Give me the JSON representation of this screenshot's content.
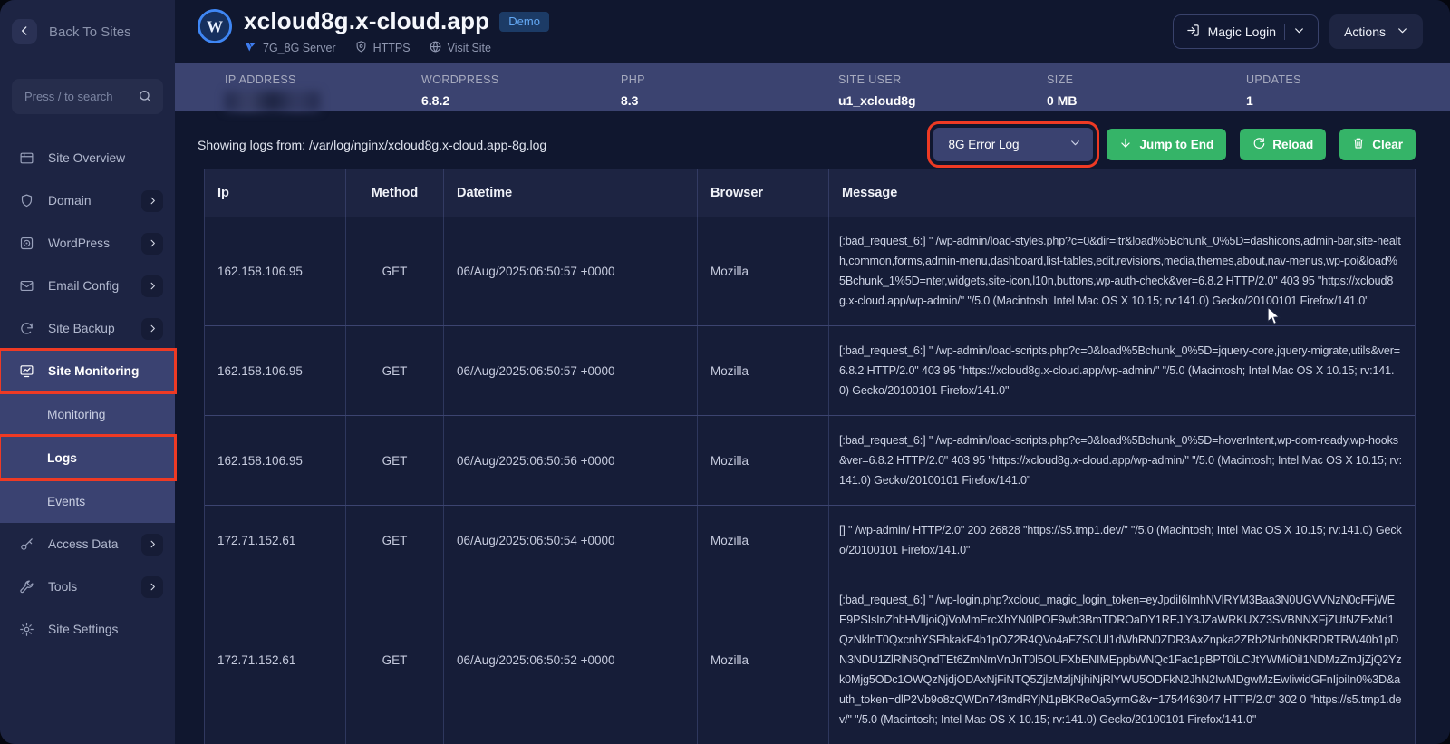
{
  "app": {
    "back_to_sites": "Back To Sites",
    "search_placeholder": "Press / to search"
  },
  "sidebar": {
    "items": [
      {
        "label": "Site Overview",
        "icon": "overview"
      },
      {
        "label": "Domain",
        "icon": "shield",
        "expandable": true
      },
      {
        "label": "WordPress",
        "icon": "wordpress",
        "expandable": true
      },
      {
        "label": "Email Config",
        "icon": "envelope",
        "expandable": true
      },
      {
        "label": "Site Backup",
        "icon": "backup",
        "expandable": true
      },
      {
        "label": "Site Monitoring",
        "icon": "monitoring",
        "active": true,
        "annotated": true
      },
      {
        "label": "Monitoring",
        "submenu": true
      },
      {
        "label": "Logs",
        "submenu": true,
        "active": true,
        "annotated": true
      },
      {
        "label": "Events",
        "submenu": true
      },
      {
        "label": "Access Data",
        "icon": "key",
        "expandable": true
      },
      {
        "label": "Tools",
        "icon": "tools",
        "expandable": true
      },
      {
        "label": "Site Settings",
        "icon": "gear"
      }
    ]
  },
  "header": {
    "site_title": "xcloud8g.x-cloud.app",
    "demo_badge": "Demo",
    "server_label": "7G_8G Server",
    "https_label": "HTTPS",
    "visit_site_label": "Visit Site",
    "magic_login_label": "Magic Login",
    "actions_label": "Actions"
  },
  "info_bar": {
    "items": [
      {
        "label": "IP ADDRESS",
        "value": "",
        "redacted": true
      },
      {
        "label": "WORDPRESS",
        "value": "6.8.2"
      },
      {
        "label": "PHP",
        "value": "8.3"
      },
      {
        "label": "SITE USER",
        "value": "u1_xcloud8g"
      },
      {
        "label": "SIZE",
        "value": "0 MB"
      },
      {
        "label": "UPDATES",
        "value": "1"
      }
    ]
  },
  "log_toolbar": {
    "showing_logs_text": "Showing logs from: /var/log/nginx/xcloud8g.x-cloud.app-8g.log",
    "log_select_value": "8G Error Log",
    "jump_to_end_label": "Jump to End",
    "reload_label": "Reload",
    "clear_label": "Clear"
  },
  "log_table": {
    "columns": [
      "Ip",
      "Method",
      "Datetime",
      "Browser",
      "Message"
    ],
    "rows": [
      {
        "ip": "162.158.106.95",
        "method": "GET",
        "datetime": "06/Aug/2025:06:50:57 +0000",
        "browser": "Mozilla",
        "message": "[:bad_request_6:] \" /wp-admin/load-styles.php?c=0&dir=ltr&load%5Bchunk_0%5D=dashicons,admin-bar,site-health,common,forms,admin-menu,dashboard,list-tables,edit,revisions,media,themes,about,nav-menus,wp-poi&load%5Bchunk_1%5D=nter,widgets,site-icon,l10n,buttons,wp-auth-check&ver=6.8.2 HTTP/2.0\" 403 95 \"https://xcloud8g.x-cloud.app/wp-admin/\" \"/5.0 (Macintosh; Intel Mac OS X 10.15; rv:141.0) Gecko/20100101 Firefox/141.0\""
      },
      {
        "ip": "162.158.106.95",
        "method": "GET",
        "datetime": "06/Aug/2025:06:50:57 +0000",
        "browser": "Mozilla",
        "message": "[:bad_request_6:] \" /wp-admin/load-scripts.php?c=0&load%5Bchunk_0%5D=jquery-core,jquery-migrate,utils&ver=6.8.2 HTTP/2.0\" 403 95 \"https://xcloud8g.x-cloud.app/wp-admin/\" \"/5.0 (Macintosh; Intel Mac OS X 10.15; rv:141.0) Gecko/20100101 Firefox/141.0\""
      },
      {
        "ip": "162.158.106.95",
        "method": "GET",
        "datetime": "06/Aug/2025:06:50:56 +0000",
        "browser": "Mozilla",
        "message": "[:bad_request_6:] \" /wp-admin/load-scripts.php?c=0&load%5Bchunk_0%5D=hoverIntent,wp-dom-ready,wp-hooks&ver=6.8.2 HTTP/2.0\" 403 95 \"https://xcloud8g.x-cloud.app/wp-admin/\" \"/5.0 (Macintosh; Intel Mac OS X 10.15; rv:141.0) Gecko/20100101 Firefox/141.0\""
      },
      {
        "ip": "172.71.152.61",
        "method": "GET",
        "datetime": "06/Aug/2025:06:50:54 +0000",
        "browser": "Mozilla",
        "message": "[] \" /wp-admin/ HTTP/2.0\" 200 26828 \"https://s5.tmp1.dev/\" \"/5.0 (Macintosh; Intel Mac OS X 10.15; rv:141.0) Gecko/20100101 Firefox/141.0\""
      },
      {
        "ip": "172.71.152.61",
        "method": "GET",
        "datetime": "06/Aug/2025:06:50:52 +0000",
        "browser": "Mozilla",
        "message": "[:bad_request_6:] \" /wp-login.php?xcloud_magic_login_token=eyJpdiI6ImhNVlRYM3Baa3N0UGVVNzN0cFFjWEE9PSIsInZhbHVlIjoiQjVoMmErcXhYN0lPOE9wb3BmTDROaDY1REJiY3JZaWRKUXZ3SVBNNXFjZUtNZExNd1QzNklnT0QxcnhYSFhkakF4b1pOZ2R4QVo4aFZSOUl1dWhRN0ZDR3AxZnpka2ZRb2Nnb0NKRDRTRW40b1pDN3NDU1ZlRlN6QndTEt6ZmNmVnJnT0l5OUFXbENIMEppbWNQc1Fac1pBPT0iLCJtYWMiOiI1NDMzZmJjZjQ2Yzk0Mjg5ODc1OWQzNjdjODAxNjFiNTQ5ZjlzMzljNjhiNjRlYWU5ODFkN2JhN2IwMDgwMzEwIiwidGFnIjoiIn0%3D&auth_token=dlP2Vb9o8zQWDn743mdRYjN1pBKReOa5yrmG&v=1754463047 HTTP/2.0\" 302 0 \"https://s5.tmp1.dev/\" \"/5.0 (Macintosh; Intel Mac OS X 10.15; rv:141.0) Gecko/20100101 Firefox/141.0\""
      }
    ]
  },
  "colors": {
    "annotation_red": "#ee3a24",
    "button_green": "#35b468",
    "accent_blue": "#3f7df0",
    "info_bar_bg": "#3b4370",
    "sidebar_bg": "#1d2443",
    "main_bg": "#10172f",
    "active_nav_bg": "#3a4271"
  }
}
